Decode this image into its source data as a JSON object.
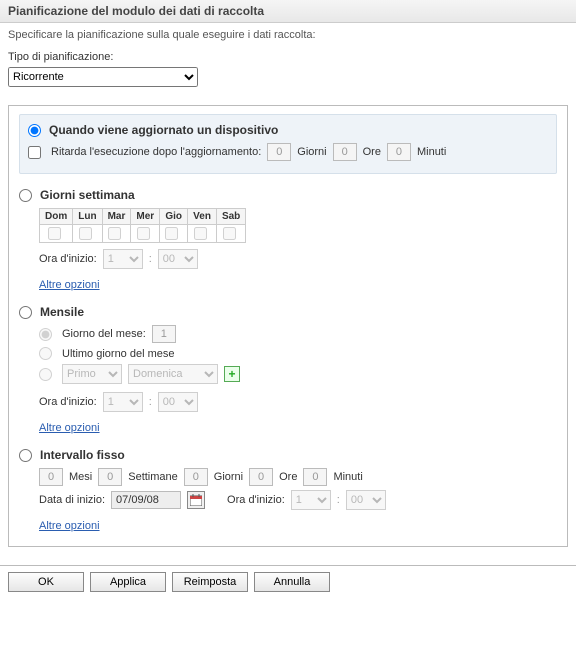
{
  "header": {
    "title": "Pianificazione del modulo dei dati di raccolta",
    "subtitle": "Specificare la pianificazione sulla quale eseguire i dati raccolta:"
  },
  "schedule_type": {
    "label": "Tipo di pianificazione:",
    "selected": "Ricorrente"
  },
  "opt_refresh": {
    "title": "Quando viene aggiornato un dispositivo",
    "delay_label": "Ritarda l'esecuzione dopo l'aggiornamento:",
    "days_label": "Giorni",
    "hours_label": "Ore",
    "minutes_label": "Minuti",
    "days_val": "0",
    "hours_val": "0",
    "minutes_val": "0"
  },
  "opt_weekly": {
    "title": "Giorni settimana",
    "days": [
      "Dom",
      "Lun",
      "Mar",
      "Mer",
      "Gio",
      "Ven",
      "Sab"
    ],
    "start_label": "Ora d'inizio:",
    "hour_val": "1",
    "min_val": "00",
    "more": "Altre opzioni"
  },
  "opt_monthly": {
    "title": "Mensile",
    "dom_label": "Giorno del mese:",
    "dom_val": "1",
    "last_label": "Ultimo giorno del mese",
    "ord_val": "Primo",
    "dow_val": "Domenica",
    "start_label": "Ora d'inizio:",
    "hour_val": "1",
    "min_val": "00",
    "more": "Altre opzioni"
  },
  "opt_fixed": {
    "title": "Intervallo fisso",
    "months_label": "Mesi",
    "weeks_label": "Settimane",
    "days_label": "Giorni",
    "hours_label": "Ore",
    "minutes_label": "Minuti",
    "months_val": "0",
    "weeks_val": "0",
    "days_val": "0",
    "hours_val": "0",
    "minutes_val": "0",
    "start_date_label": "Data di inizio:",
    "start_date_val": "07/09/08",
    "start_time_label": "Ora d'inizio:",
    "hour_val": "1",
    "min_val": "00",
    "more": "Altre opzioni"
  },
  "buttons": {
    "ok": "OK",
    "apply": "Applica",
    "reset": "Reimposta",
    "cancel": "Annulla"
  }
}
